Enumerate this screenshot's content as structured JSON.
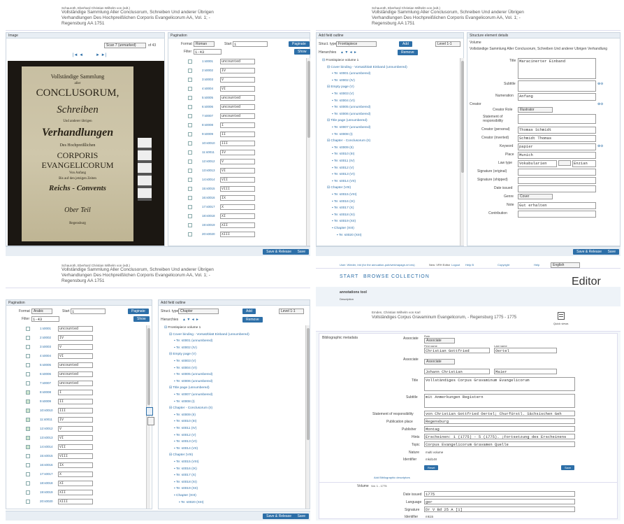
{
  "record": {
    "author": "Schauroth, Eberhard Christian Wilhelm von (edt.)",
    "title": "Vollständige Sammlung Aller Conclusorum, Schreiben Und anderer Übrigen Verhandlungen Des Hochpreißlichen Corporis Evangelicorum AA, Vol. 1; - Regensburg AA 1751"
  },
  "q1": {
    "image_label": "Image",
    "pagination_label": "Pagination",
    "scan_select": "Scan 7 (unmarked)",
    "of": "of 43",
    "nav_prev": "|◄ ◄",
    "nav_next": "► ►|",
    "format_label": "Format",
    "format_value": "Roman",
    "start_label": "Start",
    "start_value": "1",
    "paginate_btn": "Paginate",
    "filter_label": "Filter",
    "filter_value": "1-43",
    "show_btn": "Show",
    "cover": {
      "l1": "Vollständige Sammlung",
      "l2": "aller",
      "l3": "CONCLUSORUM,",
      "l4": "Schreiben",
      "l5": "Und anderer übrigen",
      "l6": "Verhandlungen",
      "l7": "Des Hochpreißlichen",
      "l8": "CORPORIS",
      "l9": "EVANGELICORUM",
      "l10": "Von Anfang",
      "l11": "Bis auf den jetzigen Zeiten",
      "l12": "Reichs - Convents",
      "l13": "Ober Teil",
      "l14": "Regensburg"
    },
    "rows": [
      {
        "n": "1:s0001",
        "v": "uncounted",
        "c": false
      },
      {
        "n": "2:s0002",
        "v": "IV",
        "c": false
      },
      {
        "n": "3:s0003",
        "v": "V",
        "c": false
      },
      {
        "n": "4:s0004",
        "v": "VI",
        "c": false
      },
      {
        "n": "5:s0005",
        "v": "uncounted",
        "c": false
      },
      {
        "n": "6:s0006",
        "v": "uncounted",
        "c": false
      },
      {
        "n": "7:s0007",
        "v": "uncounted",
        "c": false
      },
      {
        "n": "8:s0008",
        "v": "I",
        "c": false
      },
      {
        "n": "9:s0009",
        "v": "II",
        "c": false
      },
      {
        "n": "10:s0010",
        "v": "III",
        "c": false
      },
      {
        "n": "11:s0011",
        "v": "IV",
        "c": false
      },
      {
        "n": "12:s0012",
        "v": "V",
        "c": false
      },
      {
        "n": "13:s0013",
        "v": "VI",
        "c": false
      },
      {
        "n": "14:s0014",
        "v": "VII",
        "c": false
      },
      {
        "n": "15:s0015",
        "v": "VIII",
        "c": false
      },
      {
        "n": "16:s0016",
        "v": "IX",
        "c": false
      },
      {
        "n": "17:s0017",
        "v": "X",
        "c": false
      },
      {
        "n": "18:s0018",
        "v": "XI",
        "c": false
      },
      {
        "n": "19:s0019",
        "v": "XII",
        "c": false
      },
      {
        "n": "20:s0020",
        "v": "XIII",
        "c": false
      }
    ],
    "save_btn": "Save & Release",
    "save2_btn": "Save"
  },
  "q2": {
    "outline_label": "Add field outline",
    "struct_label": "Struct. type",
    "struct_value": "Frontispiece",
    "add_btn": "Add",
    "level_value": "Level 1-1",
    "remove_btn": "Remove",
    "hierarchy_label": "Hierarchies",
    "volume_label": "Structure element details",
    "volume_type": "Volume",
    "volume_title": "Vollständige Sammlung Aller Conclusorum, Schreiben Und anderer Übrigen Verhandlung",
    "fields": {
      "title_lbl": "Title",
      "title_val": "Maracinerter Einband",
      "subtitle_lbl": "Subtitle",
      "numeration_lbl": "Numeration",
      "numeration_val": "Anfang",
      "creator_lbl": "Creator",
      "creator_role_lbl": "Creator Role",
      "creator_role_val": "Illustrator",
      "statement_lbl": "Statement of responsibility",
      "creator_personal_lbl": "Creator (personal)",
      "creator_personal_val": "Thomas Schmidt",
      "creator_inverted_lbl": "Creator (inverted)",
      "creator_inverted_val": "Schmidt Thomas",
      "keyword_lbl": "Keyword",
      "keyword_val": "papier",
      "place_lbl": "Place",
      "place_val": "Munich",
      "lawtype_lbl": "Law type",
      "lawtype_val": "Vokabularien",
      "lawtype_val2": "Enzian",
      "signature_orig_lbl": "Signature (original)",
      "signature_ship_lbl": "Signature (shipped)",
      "date_lbl": "Date issued",
      "genre_lbl": "Genre",
      "genre_val": "Cover",
      "note_lbl": "Note",
      "note_val": "Gut erhalten",
      "contrib_lbl": "Contribution"
    },
    "tree": [
      {
        "t": "Frontispiece volume 1",
        "d": 0
      },
      {
        "t": "Cover binding - Vorsatzblatt Einband (unnumbered)",
        "d": 1
      },
      {
        "t": "Te: s0001 (unnumbered)",
        "d": 2
      },
      {
        "t": "Te: s0002 (IV)",
        "d": 2
      },
      {
        "t": "Empty page (V)",
        "d": 1
      },
      {
        "t": "Te: s0003 (V)",
        "d": 2
      },
      {
        "t": "Te: s0004 (VI)",
        "d": 2
      },
      {
        "t": "Te: s0005 (unnumbered)",
        "d": 2
      },
      {
        "t": "Te: s0006 (unnumbered)",
        "d": 2
      },
      {
        "t": "Title page (unnumbered)",
        "d": 1
      },
      {
        "t": "Te: s0007 (unnumbered)",
        "d": 2
      },
      {
        "t": "Te: s0008 (I)",
        "d": 2
      },
      {
        "t": "Chapter - Conclusorum (II)",
        "d": 1
      },
      {
        "t": "Te: s0009 (II)",
        "d": 2
      },
      {
        "t": "Te: s0010 (III)",
        "d": 2
      },
      {
        "t": "Te: s0011 (IV)",
        "d": 2
      },
      {
        "t": "Te: s0012 (V)",
        "d": 2
      },
      {
        "t": "Te: s0013 (VI)",
        "d": 2
      },
      {
        "t": "Te: s0014 (VII)",
        "d": 2
      },
      {
        "t": "Chapter (VIII)",
        "d": 1
      },
      {
        "t": "Te: s0015 (VIII)",
        "d": 2
      },
      {
        "t": "Te: s0016 (IX)",
        "d": 2
      },
      {
        "t": "Te: s0017 (X)",
        "d": 2
      },
      {
        "t": "Te: s0018 (XI)",
        "d": 2
      },
      {
        "t": "Te: s0019 (XII)",
        "d": 2
      },
      {
        "t": "Chapter (XIII)",
        "d": 2
      },
      {
        "t": "Te: s0020 (XIII)",
        "d": 3
      }
    ],
    "save_btn": "Save & Release",
    "save2_btn": "Save"
  },
  "q3": {
    "pagination_label": "Pagination",
    "format_label": "Format",
    "format_value": "Arabic",
    "start_label": "Start",
    "start_value": "1",
    "paginate_btn": "Paginate",
    "filter_label": "Filter",
    "filter_value": "1-43",
    "show_btn": "Show",
    "outline_label": "Add field outline",
    "struct_label": "Struct. type",
    "struct_value": "Chapter",
    "add_btn": "Add",
    "level_value": "Level 1-1",
    "remove_btn": "Remove",
    "hierarchy_label": "Hierarchies",
    "rows": [
      {
        "n": "1:s0001",
        "v": "uncounted",
        "c": false
      },
      {
        "n": "2:s0002",
        "v": "IV",
        "c": false
      },
      {
        "n": "3:s0003",
        "v": "V",
        "c": false
      },
      {
        "n": "4:s0004",
        "v": "VI",
        "c": false
      },
      {
        "n": "5:s0005",
        "v": "uncounted",
        "c": false
      },
      {
        "n": "6:s0006",
        "v": "uncounted",
        "c": false
      },
      {
        "n": "7:s0007",
        "v": "uncounted",
        "c": false
      },
      {
        "n": "8:s0008",
        "v": "I",
        "c": true
      },
      {
        "n": "9:s0009",
        "v": "II",
        "c": true
      },
      {
        "n": "10:s0010",
        "v": "III",
        "c": true
      },
      {
        "n": "11:s0011",
        "v": "IV",
        "c": true
      },
      {
        "n": "12:s0012",
        "v": "V",
        "c": true
      },
      {
        "n": "13:s0013",
        "v": "VI",
        "c": true
      },
      {
        "n": "14:s0014",
        "v": "VII",
        "c": true
      },
      {
        "n": "15:s0015",
        "v": "VIII",
        "c": false
      },
      {
        "n": "16:s0016",
        "v": "IX",
        "c": false
      },
      {
        "n": "17:s0017",
        "v": "X",
        "c": false
      },
      {
        "n": "18:s0018",
        "v": "XI",
        "c": false
      },
      {
        "n": "19:s0019",
        "v": "XII",
        "c": false
      },
      {
        "n": "20:s0020",
        "v": "XIII",
        "c": false
      }
    ],
    "save_btn": "Save & Release",
    "save2_btn": "Save"
  },
  "q4": {
    "topbar": {
      "user": "User: Wieder, Irid (for the annuation-pub/welchapage-nrt.ms)",
      "role": "New: VRH Editor",
      "logout": "Logout",
      "help": "Help B",
      "copyright": "Copyright",
      "help2": "Help",
      "lang": "English"
    },
    "nav": {
      "start": "START",
      "browse": "BROWSE COLLECTION"
    },
    "editor": "Editor",
    "subnav": {
      "workflow": "annotations tool",
      "desc": "Description"
    },
    "rec_author": "Emden, Christian Wilhelm von Karl",
    "rec_title": "Vollständiges Corpus Gravaminum Evangelicorum, - Regensburg 1775 - 1775",
    "quick_label": "Quick views",
    "biblio": "Bibliographic metadata",
    "fields": {
      "assoc_lbl": "Associate",
      "assoc_role_lbl": "Role",
      "assoc_role_val": "Associate",
      "first_lbl": "First name",
      "first_val": "Christian Gottfried",
      "last_lbl": "Last name",
      "last_val": "Oertel",
      "assoc2_lbl": "Associate",
      "assoc2_role_val": "Associate",
      "first2_val": "Johann Christian",
      "last2_val": "Maier",
      "title_lbl": "Title",
      "title_val": "Vollständiges Corpus Gravaminum Evangelicorum",
      "subtitle_lbl": "Subtitle",
      "subtitle_val": "mit Anmerkungen Registern",
      "statement_lbl": "Statement of responsibility",
      "statement_val": "von Christian Gottfried Oertel; Churfürstl. Sächsischen Geh",
      "pubplace_lbl": "Publication place",
      "pubplace_val": "Regensburg",
      "publisher_lbl": "Publisher",
      "publisher_val": "Montag",
      "hints_lbl": "Hints",
      "hints_val": "Erscheinen: 1 (1775) - 5 (1775). ;Fortsetzung des Erscheinens",
      "topic_lbl": "Topic",
      "topic_val": "Corpus Evangelicorum  Gravamen  Quelle",
      "nature_lbl": "Nature",
      "nature_val": "multi volume",
      "identifier_lbl": "Identifier",
      "identifier_val": "mkd148",
      "add_link": "Add Bibliographic descriptors",
      "volume_lbl": "Volume",
      "volume_val": "Vol. 1 - 1775",
      "date_lbl": "Date issued",
      "date_val": "1775",
      "lang_lbl": "Language",
      "lang_val": "ger",
      "sig_lbl": "Signature",
      "sig_val": "Dr V Bd 25 A [1]",
      "ident2_lbl": "Identifier",
      "ident2_val": "mk15"
    },
    "reset_btn": "Reset",
    "save_btn": "Save"
  }
}
